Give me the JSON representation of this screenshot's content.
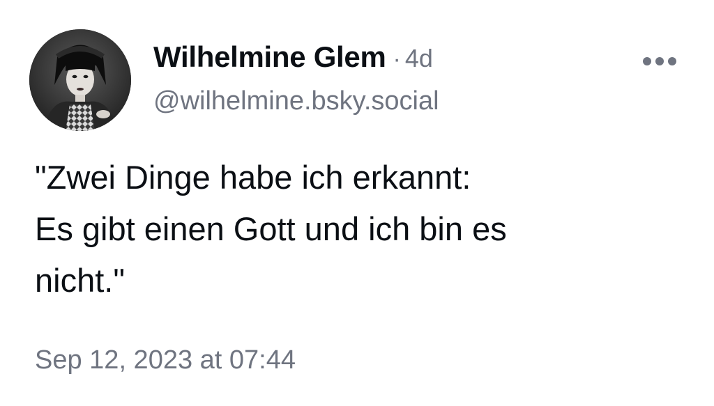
{
  "post": {
    "author": {
      "display_name": "Wilhelmine Glem",
      "handle": "@wilhelmine.bsky.social",
      "avatar": "avatar-photo"
    },
    "separator": "·",
    "relative_time": "4d",
    "menu_icon": "more-horizontal-icon",
    "text_lines": [
      "\"Zwei Dinge habe ich erkannt:",
      "Es gibt einen Gott und ich bin es",
      "nicht.\""
    ],
    "timestamp": "Sep 12, 2023 at 07:44"
  },
  "colors": {
    "primary_text": "#0b0f14",
    "secondary_text": "#6f7480",
    "background": "#ffffff"
  }
}
